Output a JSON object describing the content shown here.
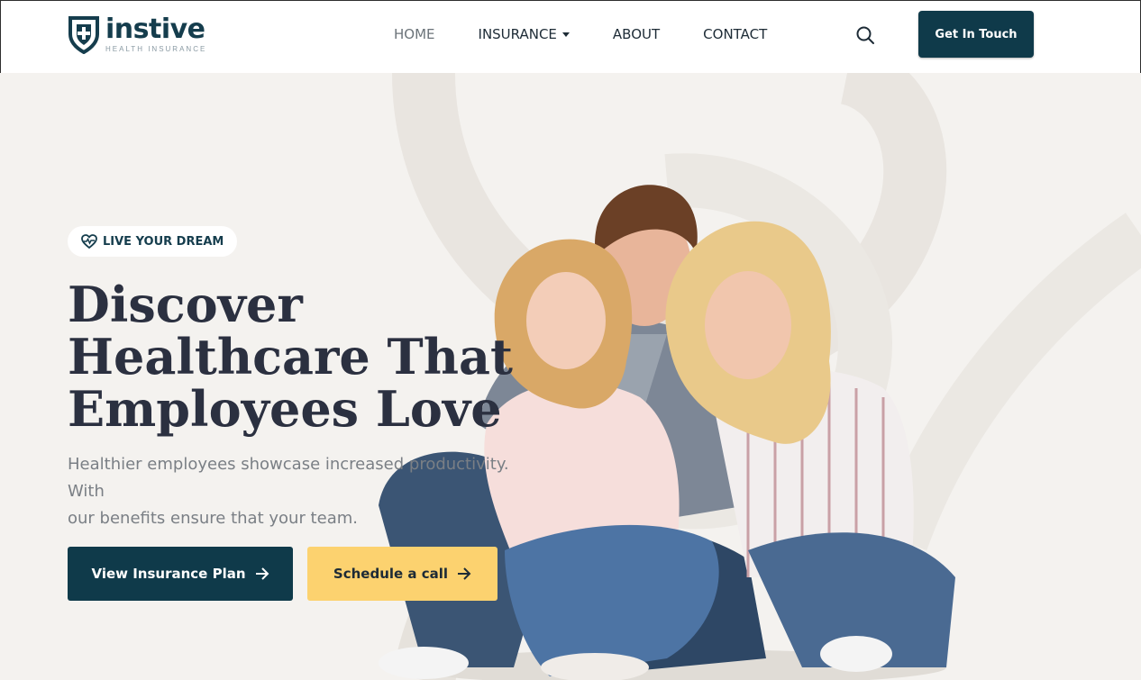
{
  "brand": {
    "name": "instive",
    "tagline": "HEALTH INSURANCE",
    "color": "#153d4d"
  },
  "nav": {
    "items": [
      {
        "label": "HOME",
        "active": true
      },
      {
        "label": "INSURANCE",
        "dropdown": true
      },
      {
        "label": "ABOUT"
      },
      {
        "label": "CONTACT"
      }
    ],
    "search_icon": "search-icon",
    "cta_label": "Get In Touch"
  },
  "hero": {
    "badge": {
      "icon": "heartbeat-icon",
      "label": "LIVE YOUR DREAM"
    },
    "headline": [
      "Discover",
      "Healthcare That",
      "Employees Love"
    ],
    "subtext": [
      "Healthier employees showcase increased productivity. With",
      "our benefits ensure that your team."
    ],
    "primary_button": {
      "label": "View Insurance Plan",
      "icon": "arrow-right-icon"
    },
    "secondary_button": {
      "label": "Schedule a call",
      "icon": "arrow-right-icon"
    }
  },
  "colors": {
    "primary": "#0f3a4a",
    "accent": "#fcd26f",
    "background": "#f4f2ef",
    "headline": "#2b3040"
  }
}
